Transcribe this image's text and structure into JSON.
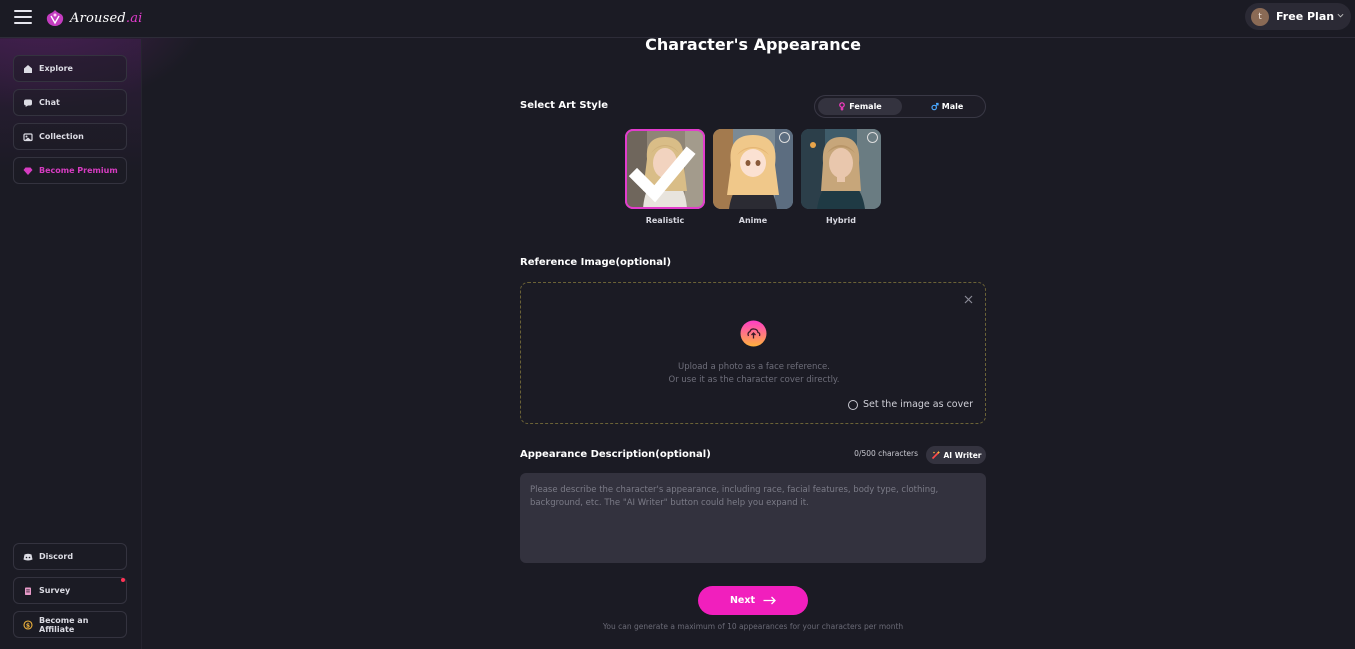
{
  "header": {
    "logo_text": "Aroused",
    "logo_suffix": ".ai",
    "avatar_initial": "t",
    "plan_label": "Free Plan"
  },
  "sidebar": {
    "items": [
      {
        "label": "Explore",
        "icon": "home-icon"
      },
      {
        "label": "Chat",
        "icon": "chat-icon"
      },
      {
        "label": "Collection",
        "icon": "collection-icon"
      },
      {
        "label": "Become Premium",
        "icon": "diamond-icon"
      }
    ],
    "bottom_items": [
      {
        "label": "Discord",
        "icon": "discord-icon"
      },
      {
        "label": "Survey",
        "icon": "survey-icon"
      },
      {
        "label": "Become an Affiliate",
        "icon": "dollar-icon"
      }
    ]
  },
  "main": {
    "title": "Character's Appearance",
    "art_style": {
      "label": "Select Art Style",
      "gender": {
        "female": "Female",
        "male": "Male",
        "selected": "Female"
      },
      "styles": [
        {
          "label": "Realistic",
          "selected": true
        },
        {
          "label": "Anime",
          "selected": false
        },
        {
          "label": "Hybrid",
          "selected": false
        }
      ]
    },
    "reference": {
      "label": "Reference Image(optional)",
      "upload_line1": "Upload a photo as a face reference.",
      "upload_line2": "Or use it as the character cover directly.",
      "cover_option": "Set the image as cover"
    },
    "description": {
      "label": "Appearance Description(optional)",
      "char_count": "0/500 characters",
      "ai_writer": "AI Writer",
      "placeholder": "Please describe the character's appearance, including race, facial features, body type, clothing, background, etc. The \"AI Writer\" button could help you expand it."
    },
    "next_label": "Next",
    "footnote": "You can generate a maximum of 10 appearances for your characters per month"
  },
  "colors": {
    "accent": "#f11fbd",
    "background": "#1b1b24",
    "brand_pink": "#e23ccd"
  }
}
